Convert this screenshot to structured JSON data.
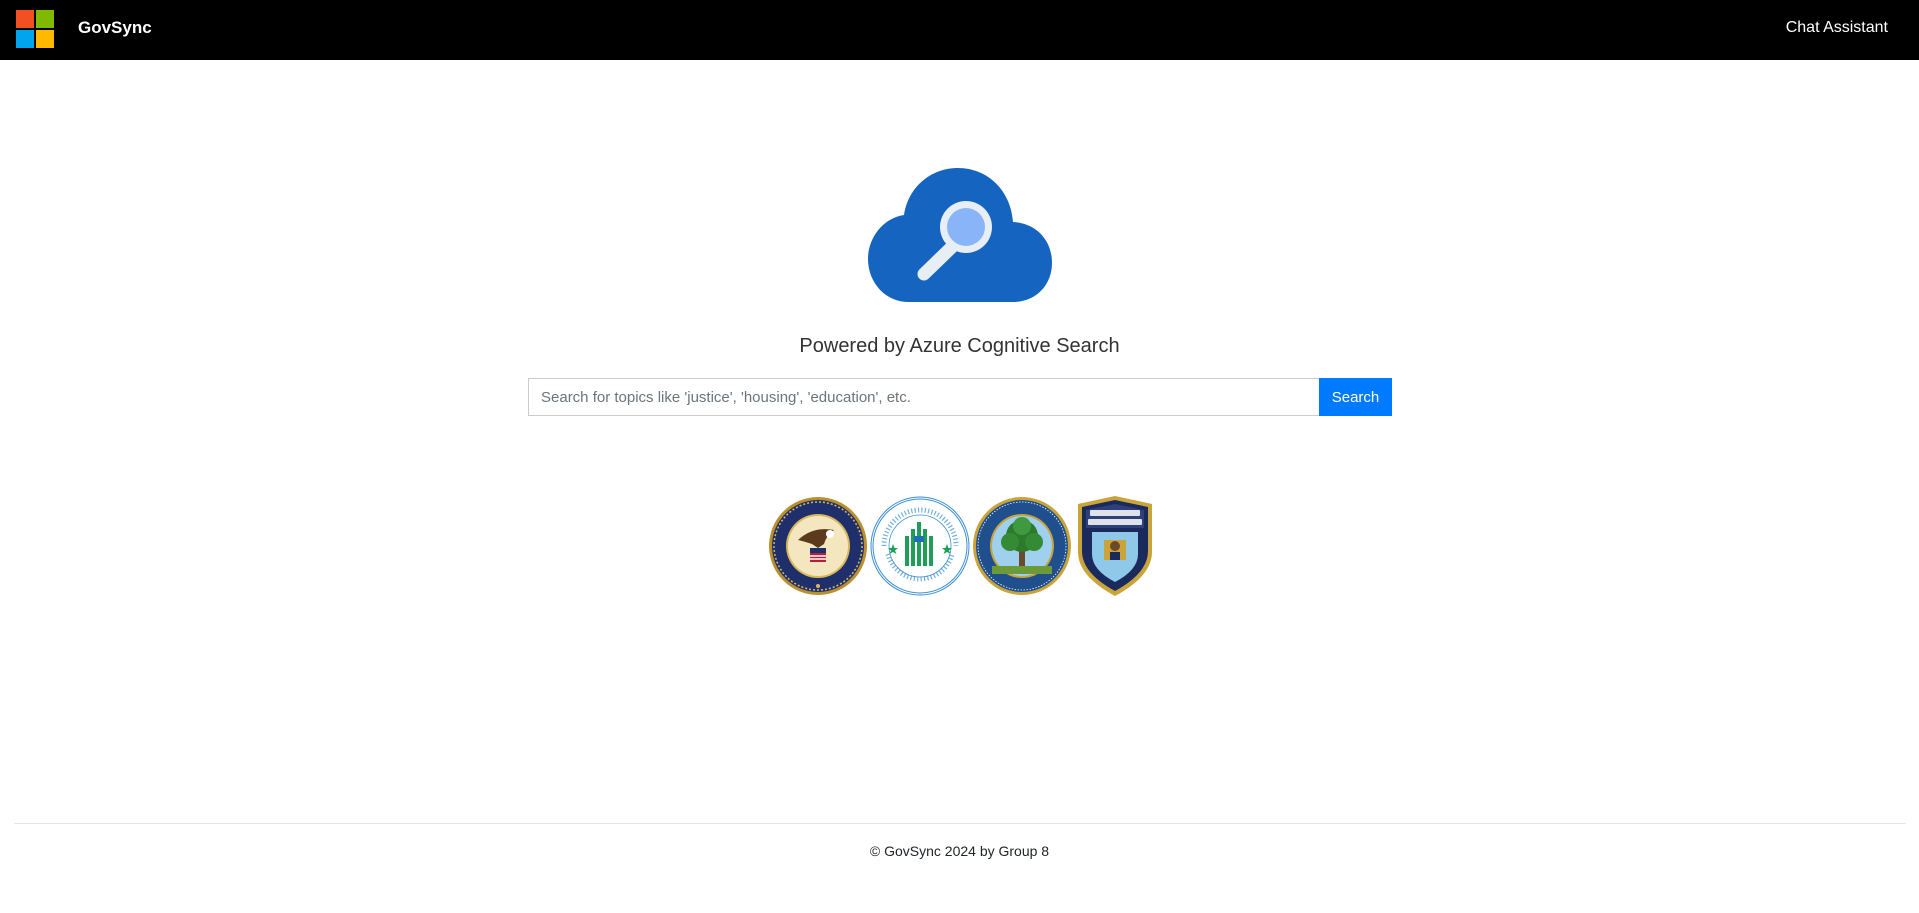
{
  "nav": {
    "brand": "GovSync",
    "chat_link": "Chat Assistant"
  },
  "colors": {
    "logo_red": "#f25022",
    "logo_green": "#7fba00",
    "logo_blue": "#00a4ef",
    "logo_yellow": "#ffb900",
    "accent": "#007bff",
    "hero_blue": "#1565c0"
  },
  "hero": {
    "icon": "cloud-search-icon",
    "tagline": "Powered by Azure Cognitive Search"
  },
  "search": {
    "placeholder": "Search for topics like 'justice', 'housing', 'education', etc.",
    "value": "",
    "button_label": "Search"
  },
  "seals": [
    {
      "icon": "department-of-justice-seal"
    },
    {
      "icon": "hud-seal"
    },
    {
      "icon": "department-of-education-seal"
    },
    {
      "icon": "nypd-badge"
    }
  ],
  "footer": {
    "copyright": "© GovSync 2024 by Group 8"
  }
}
